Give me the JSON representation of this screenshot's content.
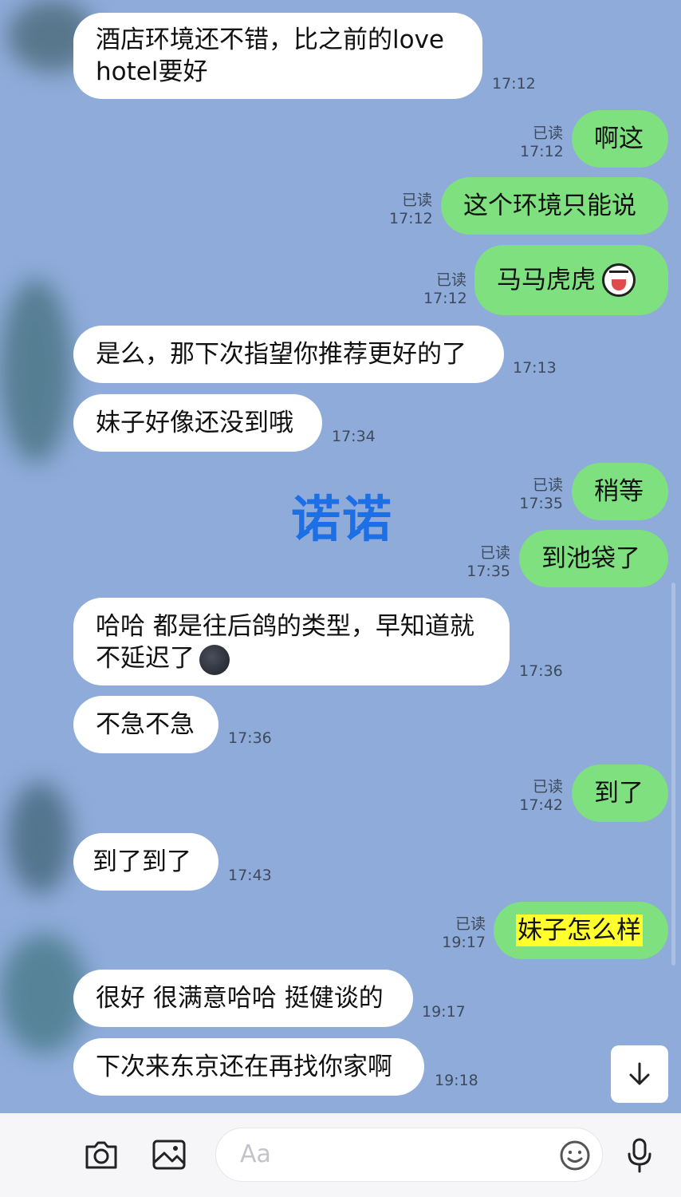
{
  "watermark": "诺诺",
  "messages": [
    {
      "side": "in",
      "lines": [
        "酒店环境还不错，比之前的love",
        "hotel要好"
      ],
      "time": "17:12"
    },
    {
      "side": "out",
      "text": "啊这",
      "read": "已读",
      "time": "17:12"
    },
    {
      "side": "out",
      "text": "这个环境只能说",
      "read": "已读",
      "time": "17:12"
    },
    {
      "side": "out",
      "text": "马马虎虎",
      "emoji": "laughing-crying-face-icon",
      "read": "已读",
      "time": "17:12"
    },
    {
      "side": "in",
      "text": "是么，那下次指望你推荐更好的了",
      "time": "17:13"
    },
    {
      "side": "in",
      "text": "妹子好像还没到哦",
      "time": "17:34"
    },
    {
      "side": "out",
      "text": "稍等",
      "read": "已读",
      "time": "17:35"
    },
    {
      "side": "out",
      "text": "到池袋了",
      "read": "已读",
      "time": "17:35"
    },
    {
      "side": "in",
      "lines": [
        "哈哈 都是往后鸽的类型，早知道就",
        "不延迟了"
      ],
      "emoji": "new-moon-face-icon",
      "time": "17:36"
    },
    {
      "side": "in",
      "text": "不急不急",
      "time": "17:36"
    },
    {
      "side": "out",
      "text": "到了",
      "read": "已读",
      "time": "17:42"
    },
    {
      "side": "in",
      "text": "到了到了",
      "time": "17:43"
    },
    {
      "side": "out",
      "text": "妹子怎么样",
      "highlight": "#ffff2e",
      "read": "已读",
      "time": "19:17"
    },
    {
      "side": "in",
      "text": "很好 很满意哈哈 挺健谈的",
      "time": "19:17"
    },
    {
      "side": "in",
      "text": "下次来东京还在再找你家啊",
      "time": "19:18"
    }
  ],
  "composer": {
    "placeholder": "Aa",
    "icons": [
      "camera-icon",
      "image-icon",
      "emoji-icon",
      "microphone-icon"
    ]
  },
  "scroll_button": "arrow-down-icon",
  "colors": {
    "background": "#8eabd9",
    "outgoing": "#7ee07e",
    "incoming": "#ffffff",
    "watermark": "#1d6fe6",
    "highlight": "#ffff2e"
  }
}
